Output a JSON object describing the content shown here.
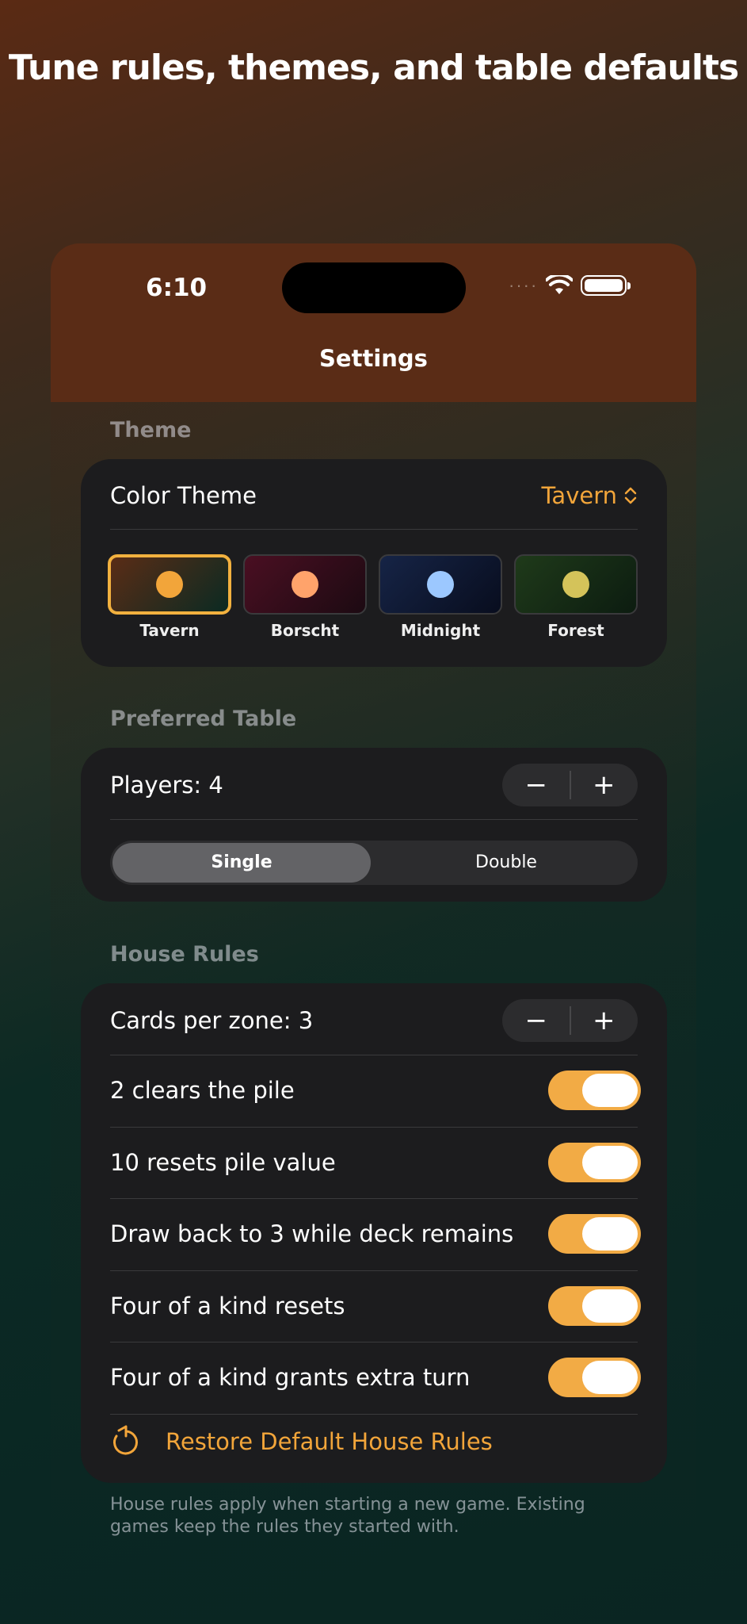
{
  "headline": "Tune rules, themes, and table defaults",
  "status": {
    "time": "6:10",
    "signal": "····"
  },
  "nav": {
    "title": "Settings"
  },
  "theme": {
    "section_label": "Theme",
    "color_theme_label": "Color Theme",
    "selected": "Tavern",
    "options": [
      {
        "name": "Tavern",
        "dot": "#f2a53a",
        "bg": "linear-gradient(135deg,#5a2c16,#0b2a22)"
      },
      {
        "name": "Borscht",
        "dot": "#ffa36b",
        "bg": "linear-gradient(135deg,#4a0f22,#1c0a12)"
      },
      {
        "name": "Midnight",
        "dot": "#9cc8ff",
        "bg": "linear-gradient(135deg,#162446,#080d1e)"
      },
      {
        "name": "Forest",
        "dot": "#d4c35a",
        "bg": "linear-gradient(135deg,#1f3a1a,#0c1c10)"
      }
    ]
  },
  "table": {
    "section_label": "Preferred Table",
    "players_label": "Players: 4",
    "minus": "−",
    "plus": "+",
    "segments": [
      "Single",
      "Double"
    ],
    "selected_segment": "Single"
  },
  "house_rules": {
    "section_label": "House Rules",
    "cards_label": "Cards per zone: 3",
    "toggles": [
      {
        "label": "2 clears the pile",
        "on": true
      },
      {
        "label": "10 resets pile value",
        "on": true
      },
      {
        "label": "Draw back to 3 while deck remains",
        "on": true
      },
      {
        "label": "Four of a kind resets",
        "on": true
      },
      {
        "label": "Four of a kind grants extra turn",
        "on": true
      }
    ],
    "restore_label": "Restore Default House Rules",
    "footnote": "House rules apply when starting a new game. Existing games keep the rules they started with."
  },
  "colors": {
    "accent": "#f2a53a",
    "card": "#1c1c1e",
    "nav": "#5a2c16"
  }
}
